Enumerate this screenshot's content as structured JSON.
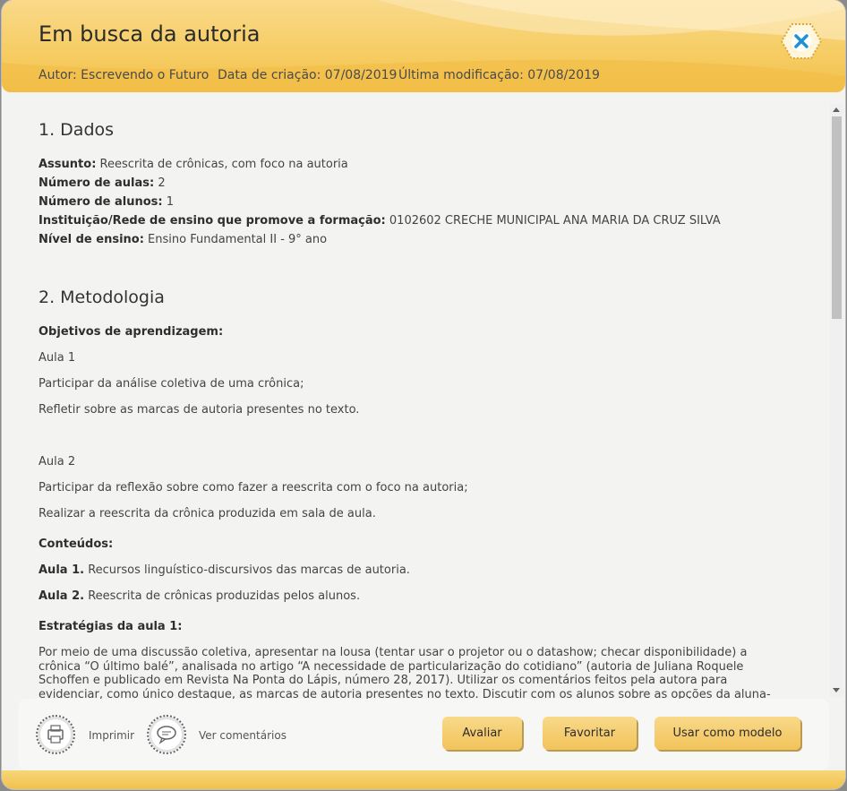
{
  "header": {
    "title": "Em busca da autoria",
    "author": "Autor: Escrevendo o Futuro",
    "created": "Data de criação: 07/08/2019",
    "modified": "Última modificação: 07/08/2019"
  },
  "section1": {
    "heading": "1. Dados",
    "fields": [
      {
        "label": "Assunto:",
        "value": " Reescrita de crônicas, com foco na autoria"
      },
      {
        "label": "Número de aulas:",
        "value": " 2"
      },
      {
        "label": "Número de alunos:",
        "value": " 1"
      },
      {
        "label": "Instituição/Rede de ensino que promove a formação:",
        "value": " 0102602 CRECHE MUNICIPAL ANA MARIA DA CRUZ SILVA"
      },
      {
        "label": "Nível de ensino:",
        "value": " Ensino Fundamental II - 9° ano"
      }
    ]
  },
  "section2": {
    "heading": "2. Metodologia",
    "objectives_label": "Objetivos de aprendizagem:",
    "aula1_label": "Aula 1",
    "aula1_items": [
      "Participar da análise coletiva de uma crônica;",
      "Refletir sobre as marcas de autoria presentes no texto."
    ],
    "aula2_label": "Aula 2",
    "aula2_items": [
      "Participar da reflexão sobre como fazer a reescrita com o foco na autoria;",
      "Realizar a reescrita da crônica produzida em sala de aula."
    ],
    "contents_label": "Conteúdos:",
    "contents": [
      {
        "label": "Aula 1.",
        "value": " Recursos linguístico-discursivos das marcas de autoria."
      },
      {
        "label": "Aula 2.",
        "value": " Reescrita de crônicas produzidas pelos alunos."
      }
    ],
    "strategies_label": "Estratégias da aula 1:",
    "strategies_text": "Por meio de uma discussão coletiva, apresentar na lousa (tentar usar o projetor ou o datashow; checar disponibilidade) a crônica “O último balé”, analisada no artigo “A necessidade de particularização do cotidiano” (autoria de Juliana Roquele Schoffen e publicado em Revista Na Ponta do Lápis, número 28, 2017). Utilizar os comentários feitos pela autora para evidenciar, como único destaque, as marcas de autoria presentes no texto. Discutir com os alunos sobre as opções da aluna-autora da crônica, os modos como compôs cada elemento de autoria"
  },
  "footer": {
    "print_label": "Imprimir",
    "comments_label": "Ver comentários",
    "rate_label": "Avaliar",
    "favorite_label": "Favoritar",
    "template_label": "Usar como modelo"
  },
  "colors": {
    "accent": "#f6cc62",
    "close_icon": "#1f8fd6"
  }
}
